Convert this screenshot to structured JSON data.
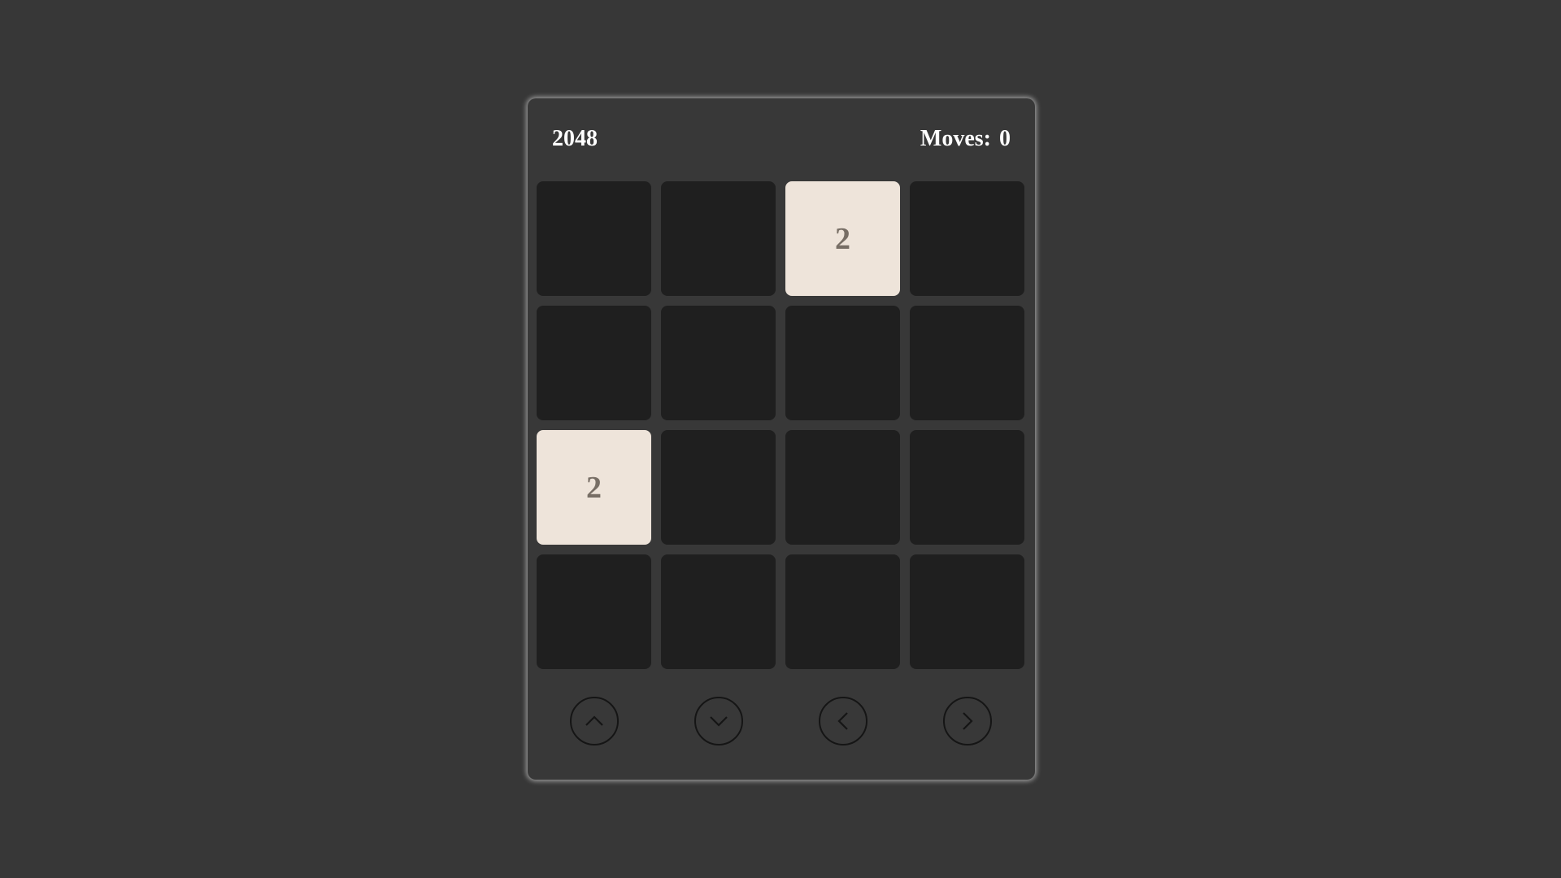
{
  "header": {
    "title": "2048",
    "moves_label": "Moves:",
    "moves_value": "0"
  },
  "board": {
    "rows": 4,
    "cols": 4,
    "cells": [
      "",
      "",
      "2",
      "",
      "",
      "",
      "",
      "",
      "2",
      "",
      "",
      "",
      "",
      "",
      "",
      ""
    ]
  },
  "colors": {
    "page_background": "#373737",
    "panel_background": "#383838",
    "empty_tile": "#1f1f1f",
    "tile_2": "#eee4da",
    "tile_text": "#776e65",
    "header_text": "#ffffff"
  },
  "controls": [
    {
      "icon": "chevron-up-icon"
    },
    {
      "icon": "chevron-down-icon"
    },
    {
      "icon": "chevron-left-icon"
    },
    {
      "icon": "chevron-right-icon"
    }
  ]
}
